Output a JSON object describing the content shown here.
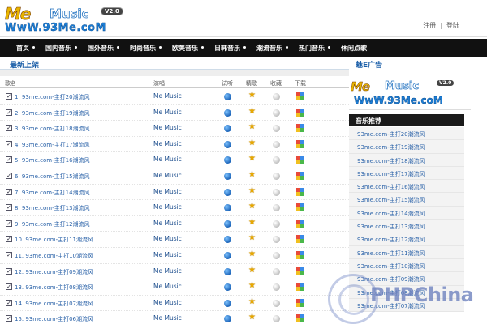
{
  "header": {
    "logo": {
      "me": "Me",
      "music": "Music",
      "version": "V2.0",
      "url": "WwW.93Me.coM"
    },
    "auth": {
      "register": "注册",
      "separator": "|",
      "login": "登陆"
    }
  },
  "nav": [
    "首页",
    "国内音乐",
    "国外音乐",
    "时尚音乐",
    "欧美音乐",
    "日韩音乐",
    "潮流音乐",
    "热门音乐",
    "休闲点歌"
  ],
  "left": {
    "section_title": "最新上架",
    "columns": {
      "song": "歌名",
      "artist": "演唱",
      "listen": "试听",
      "favorite": "精歌",
      "collect": "收藏",
      "download": "下载"
    },
    "rows": [
      {
        "title": "1. 93me.com-主打20潮流风",
        "artist": "Me Music"
      },
      {
        "title": "2. 93me.com-主打19潮流风",
        "artist": "Me Music"
      },
      {
        "title": "3. 93me.com-主打18潮流风",
        "artist": "Me Music"
      },
      {
        "title": "4. 93me.com-主打17潮流风",
        "artist": "Me Music"
      },
      {
        "title": "5. 93me.com-主打16潮流风",
        "artist": "Me Music"
      },
      {
        "title": "6. 93me.com-主打15潮流风",
        "artist": "Me Music"
      },
      {
        "title": "7. 93me.com-主打14潮流风",
        "artist": "Me Music"
      },
      {
        "title": "8. 93me.com-主打13潮流风",
        "artist": "Me Music"
      },
      {
        "title": "9. 93me.com-主打12潮流风",
        "artist": "Me Music"
      },
      {
        "title": "10. 93me.com-主打11潮流风",
        "artist": "Me Music"
      },
      {
        "title": "11. 93me.com-主打10潮流风",
        "artist": "Me Music"
      },
      {
        "title": "12. 93me.com-主打09潮流风",
        "artist": "Me Music"
      },
      {
        "title": "13. 93me.com-主打08潮流风",
        "artist": "Me Music"
      },
      {
        "title": "14. 93me.com-主打07潮流风",
        "artist": "Me Music"
      },
      {
        "title": "15. 93me.com-主打06潮流风",
        "artist": "Me Music"
      }
    ]
  },
  "right": {
    "ad_title": "魅E广告",
    "ad_logo": {
      "me": "Me",
      "music": "Music",
      "version": "V2.0",
      "url": "WwW.93Me.coM"
    },
    "rec_title": "音乐推荐",
    "rec_items": [
      "93me.com-主打20潮流风",
      "93me.com-主打19潮流风",
      "93me.com-主打18潮流风",
      "93me.com-主打17潮流风",
      "93me.com-主打16潮流风",
      "93me.com-主打15潮流风",
      "93me.com-主打14潮流风",
      "93me.com-主打13潮流风",
      "93me.com-主打12潮流风",
      "93me.com-主打11潮流风",
      "93me.com-主打10潮流风",
      "93me.com-主打09潮流风",
      "93me.com-主打08潮流风",
      "93me.com-主打07潮流风"
    ]
  },
  "watermark": {
    "text": "PHPChina"
  },
  "colors": {
    "nav_bg": "#111111",
    "link": "#2a62a8",
    "section_title": "#1a5ea8",
    "star": "#e8a800"
  },
  "icons": {
    "listen": "play-circle-icon",
    "favorite": "star-icon",
    "collect": "grey-circle-icon",
    "download": "download-icon"
  }
}
